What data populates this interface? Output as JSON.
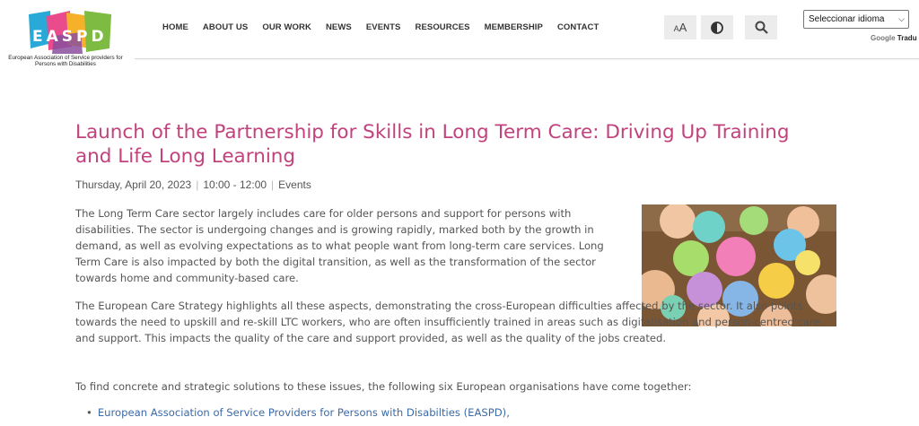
{
  "logo": {
    "text": "EASPD",
    "tagline": "European Association of Service providers for Persons with Disabilities"
  },
  "nav": {
    "items": [
      "HOME",
      "ABOUT US",
      "OUR WORK",
      "NEWS",
      "EVENTS",
      "RESOURCES",
      "MEMBERSHIP",
      "CONTACT"
    ]
  },
  "tools": {
    "font_size_icon": "font-size-icon",
    "contrast_icon": "contrast-icon",
    "search_icon": "search-icon"
  },
  "translate": {
    "select_value": "Seleccionar idioma",
    "powered_google": "Google",
    "powered_label": "Tradu"
  },
  "article": {
    "title": "Launch of the Partnership for Skills in Long Term Care: Driving Up Training and Life Long Learning",
    "date": "Thursday, April 20, 2023",
    "time": "10:00 - 12:00",
    "category": "Events",
    "p1": "The Long Term Care sector largely includes care for older persons and support for persons with disabilities. The sector is undergoing changes and is growing rapidly, marked both by the growth in demand, as well as evolving expectations as to what people want from long-term care services. Long Term Care is also impacted by both the digital transition, as well as the transformation of the sector towards home and community-based care.",
    "p2": "The European Care Strategy highlights all these aspects, demonstrating the cross-European difficulties affected by the sector. It also points towards the need to upskill and re-skill LTC workers, who are often insufficiently trained in areas such as digitalisation and person-centred care and support. This impacts the quality of the care and support provided, as well as the quality of the jobs created.",
    "p3": "To find concrete and strategic solutions to these issues, the following six European organisations have come together:",
    "organisations": [
      "European Association of Service Providers for Persons with Disabilties (EASPD),"
    ]
  },
  "colors": {
    "title": "#c1427c",
    "link": "#3b6aa8",
    "body_text": "#555555"
  }
}
